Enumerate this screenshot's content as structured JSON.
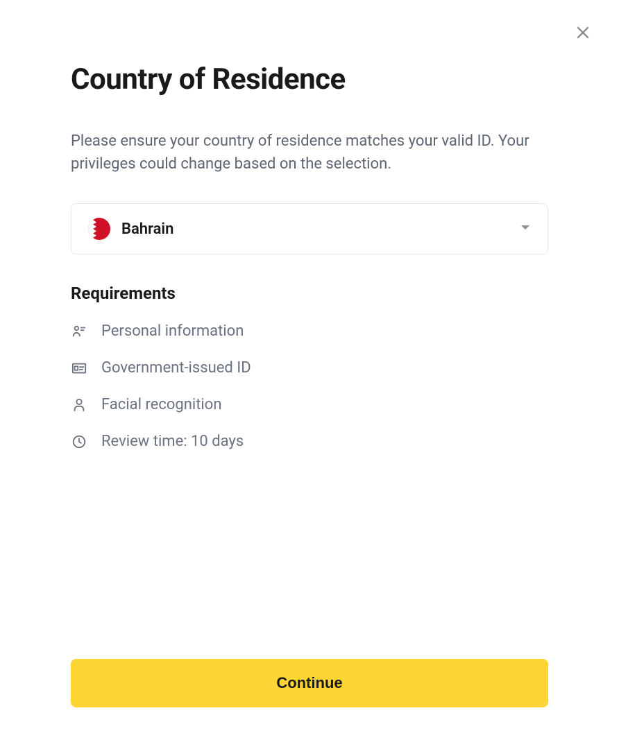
{
  "header": {
    "title": "Country of Residence",
    "description": "Please ensure your country of residence matches your valid ID. Your privileges could change based on the selection."
  },
  "country": {
    "selected": "Bahrain"
  },
  "requirements": {
    "heading": "Requirements",
    "items": [
      {
        "label": "Personal information"
      },
      {
        "label": "Government-issued ID"
      },
      {
        "label": "Facial recognition"
      },
      {
        "label": "Review time: 10 days"
      }
    ]
  },
  "actions": {
    "continue": "Continue"
  }
}
